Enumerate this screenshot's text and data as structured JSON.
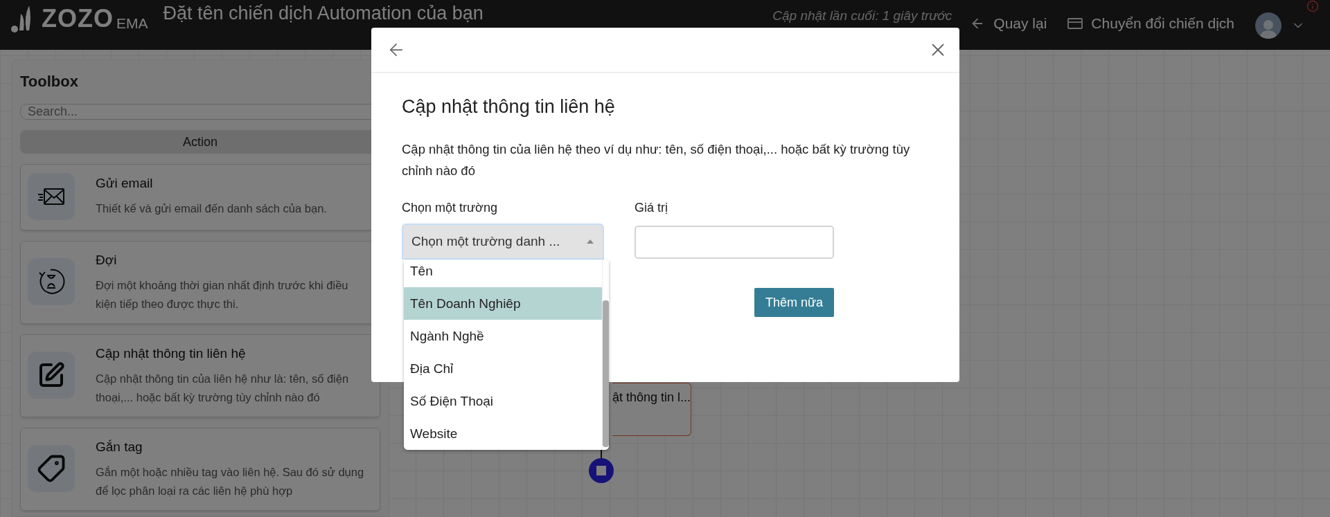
{
  "top_bar": {
    "logo": {
      "main": "ZOZO",
      "suffix": "EMA"
    },
    "title": "Đặt tên chiến dịch Automation của bạn",
    "last_updated": "Cập nhật lần cuối: 1 giây trước",
    "back": "Quay lại",
    "switch": "Chuyển đổi chiến dịch"
  },
  "toolbox": {
    "title": "Toolbox",
    "search": {
      "placeholder": "Search..."
    },
    "tabs": [
      {
        "label": "Action",
        "selected": true
      }
    ],
    "items": [
      {
        "kind": "email",
        "title": "Gửi email",
        "description": "Thiết kế và gửi email đến danh sách của bạn."
      },
      {
        "kind": "wait",
        "title": "Đợi",
        "description": "Đợi một khoảng thời gian nhất định trước khi điều kiện tiếp theo được thực thi."
      },
      {
        "kind": "edit",
        "title": "Cập nhật thông tin liên hệ",
        "description": "Cập nhật thông tin của liên hệ như là: tên, số điện thoại,... hoặc bất kỳ trường tùy chỉnh nào đó"
      },
      {
        "kind": "tag",
        "title": "Gắn tag",
        "description": "Gắn một hoặc nhiều tag vào liên hệ. Sau đó sử dụng để lọc phân loại ra các liên hệ phù hợp"
      }
    ]
  },
  "canvas": {
    "nodes": [
      {
        "kind": "action",
        "label": "ật thông tin l..."
      },
      {
        "kind": "end"
      }
    ]
  },
  "dialog": {
    "title": "Cập nhật thông tin liên hệ",
    "description": "Cập nhật thông tin của liên hệ theo ví dụ như: tên, số điện thoại,... hoặc bất kỳ trường tùy chỉnh nào đó",
    "field_label": "Chọn một trường",
    "select": {
      "value": "Chọn một trường danh ...",
      "expanded": true,
      "options": [
        {
          "label": "Tên",
          "selected": false
        },
        {
          "label": "Tên Doanh Nghiêp",
          "selected": true
        },
        {
          "label": "Ngành Nghề",
          "selected": false
        },
        {
          "label": "Địa Chỉ",
          "selected": false
        },
        {
          "label": "Số Điện Thoại",
          "selected": false
        },
        {
          "label": "Website",
          "selected": false
        }
      ]
    },
    "value_label": "Giá trị",
    "button": "Thêm nữa"
  }
}
